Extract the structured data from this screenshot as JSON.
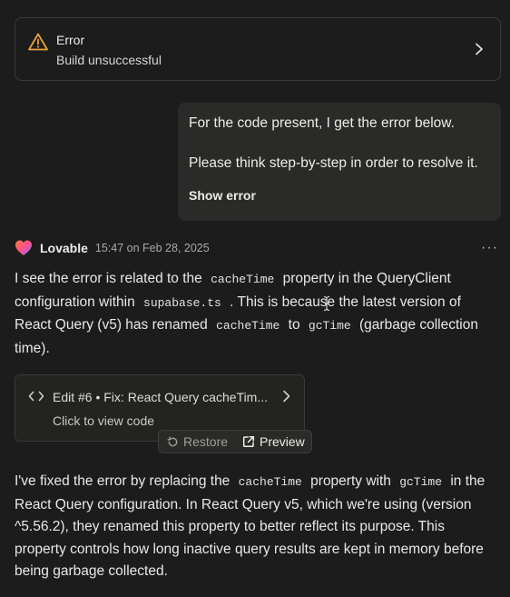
{
  "error_card": {
    "title": "Error",
    "subtitle": "Build unsuccessful",
    "icon": "warning-icon",
    "accent": "#e7a23b"
  },
  "user_message": {
    "line1": "For the code present, I get the error below.",
    "line2": "Please think step-by-step in order to resolve it.",
    "show_error": "Show error"
  },
  "assistant": {
    "name": "Lovable",
    "timestamp": "15:47 on Feb 28, 2025",
    "more": "···"
  },
  "paragraph1": {
    "t1": "I see the error is related to the",
    "c1": "cacheTime",
    "t2": "property in the QueryClient configuration within",
    "c2": "supabase.ts",
    "t3": ". This is because the latest version of React Query (v5) has renamed",
    "c3": "cacheTime",
    "t4": "to",
    "c4": "gcTime",
    "t5": "(garbage collection time)."
  },
  "edit_card": {
    "title": "Edit #6 • Fix: React Query cacheTim...",
    "subtitle": "Click to view code"
  },
  "actions": {
    "restore": "Restore",
    "preview": "Preview"
  },
  "paragraph2": {
    "t1": "I've fixed the error by replacing the",
    "c1": "cacheTime",
    "t2": "property with",
    "c2": "gcTime",
    "t3": "in the React Query configuration. In React Query v5, which we're using (version ^5.56.2), they renamed this property to better reflect its purpose. This property controls how long inactive query results are kept in memory before being garbage collected."
  }
}
